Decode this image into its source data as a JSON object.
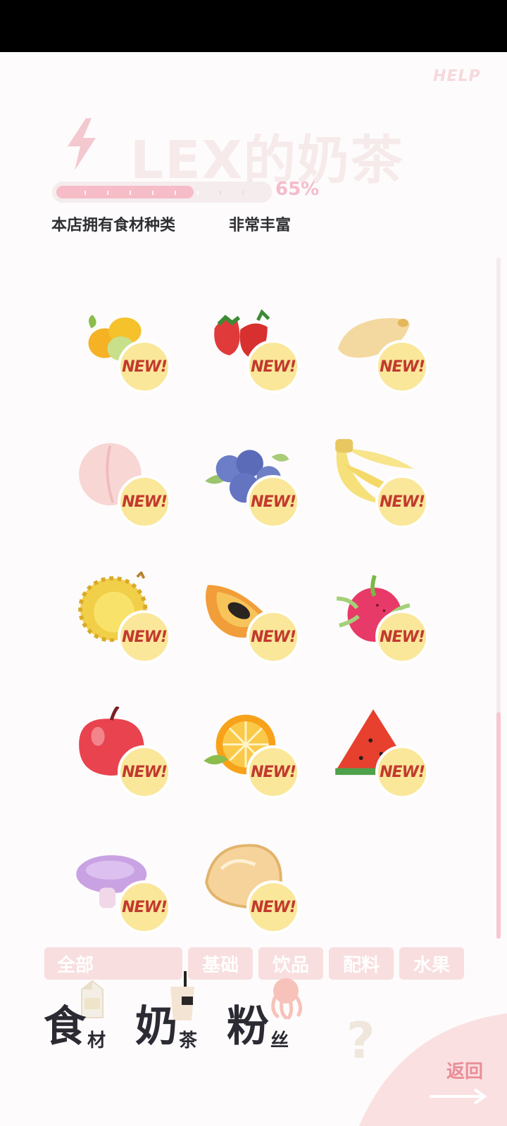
{
  "header": {
    "help": "HELP",
    "title": "LEX的奶茶",
    "progress": {
      "value": 0.65,
      "label": "65%"
    },
    "stock_label": "本店拥有食材种类",
    "stock_value": "非常丰富"
  },
  "badge_text": "NEW!",
  "ingredients": [
    {
      "icon": "lemon-icon"
    },
    {
      "icon": "strawberry-icon"
    },
    {
      "icon": "mango-icon"
    },
    {
      "icon": "peach-icon"
    },
    {
      "icon": "blueberry-icon"
    },
    {
      "icon": "banana-icon"
    },
    {
      "icon": "durian-icon"
    },
    {
      "icon": "papaya-icon"
    },
    {
      "icon": "dragonfruit-icon"
    },
    {
      "icon": "apple-icon"
    },
    {
      "icon": "orange-icon"
    },
    {
      "icon": "watermelon-icon"
    },
    {
      "icon": "taro-icon"
    },
    {
      "icon": "fortune-cookie-icon"
    }
  ],
  "filter_tabs": [
    "全部",
    "基础",
    "饮品",
    "配料",
    "水果"
  ],
  "bottom_nav": [
    {
      "big": "食",
      "small": "材",
      "icon": "milk-carton-icon"
    },
    {
      "big": "奶",
      "small": "茶",
      "icon": "bubble-tea-icon"
    },
    {
      "big": "粉",
      "small": "丝",
      "icon": "octopus-icon"
    },
    {
      "big": "?",
      "small": ""
    }
  ],
  "back_label": "返回",
  "colors": {
    "accent_pink": "#f6bcc8",
    "badge_yellow": "#fbe79a",
    "badge_red": "#c23a2f",
    "tab_bg": "#f8dede"
  }
}
